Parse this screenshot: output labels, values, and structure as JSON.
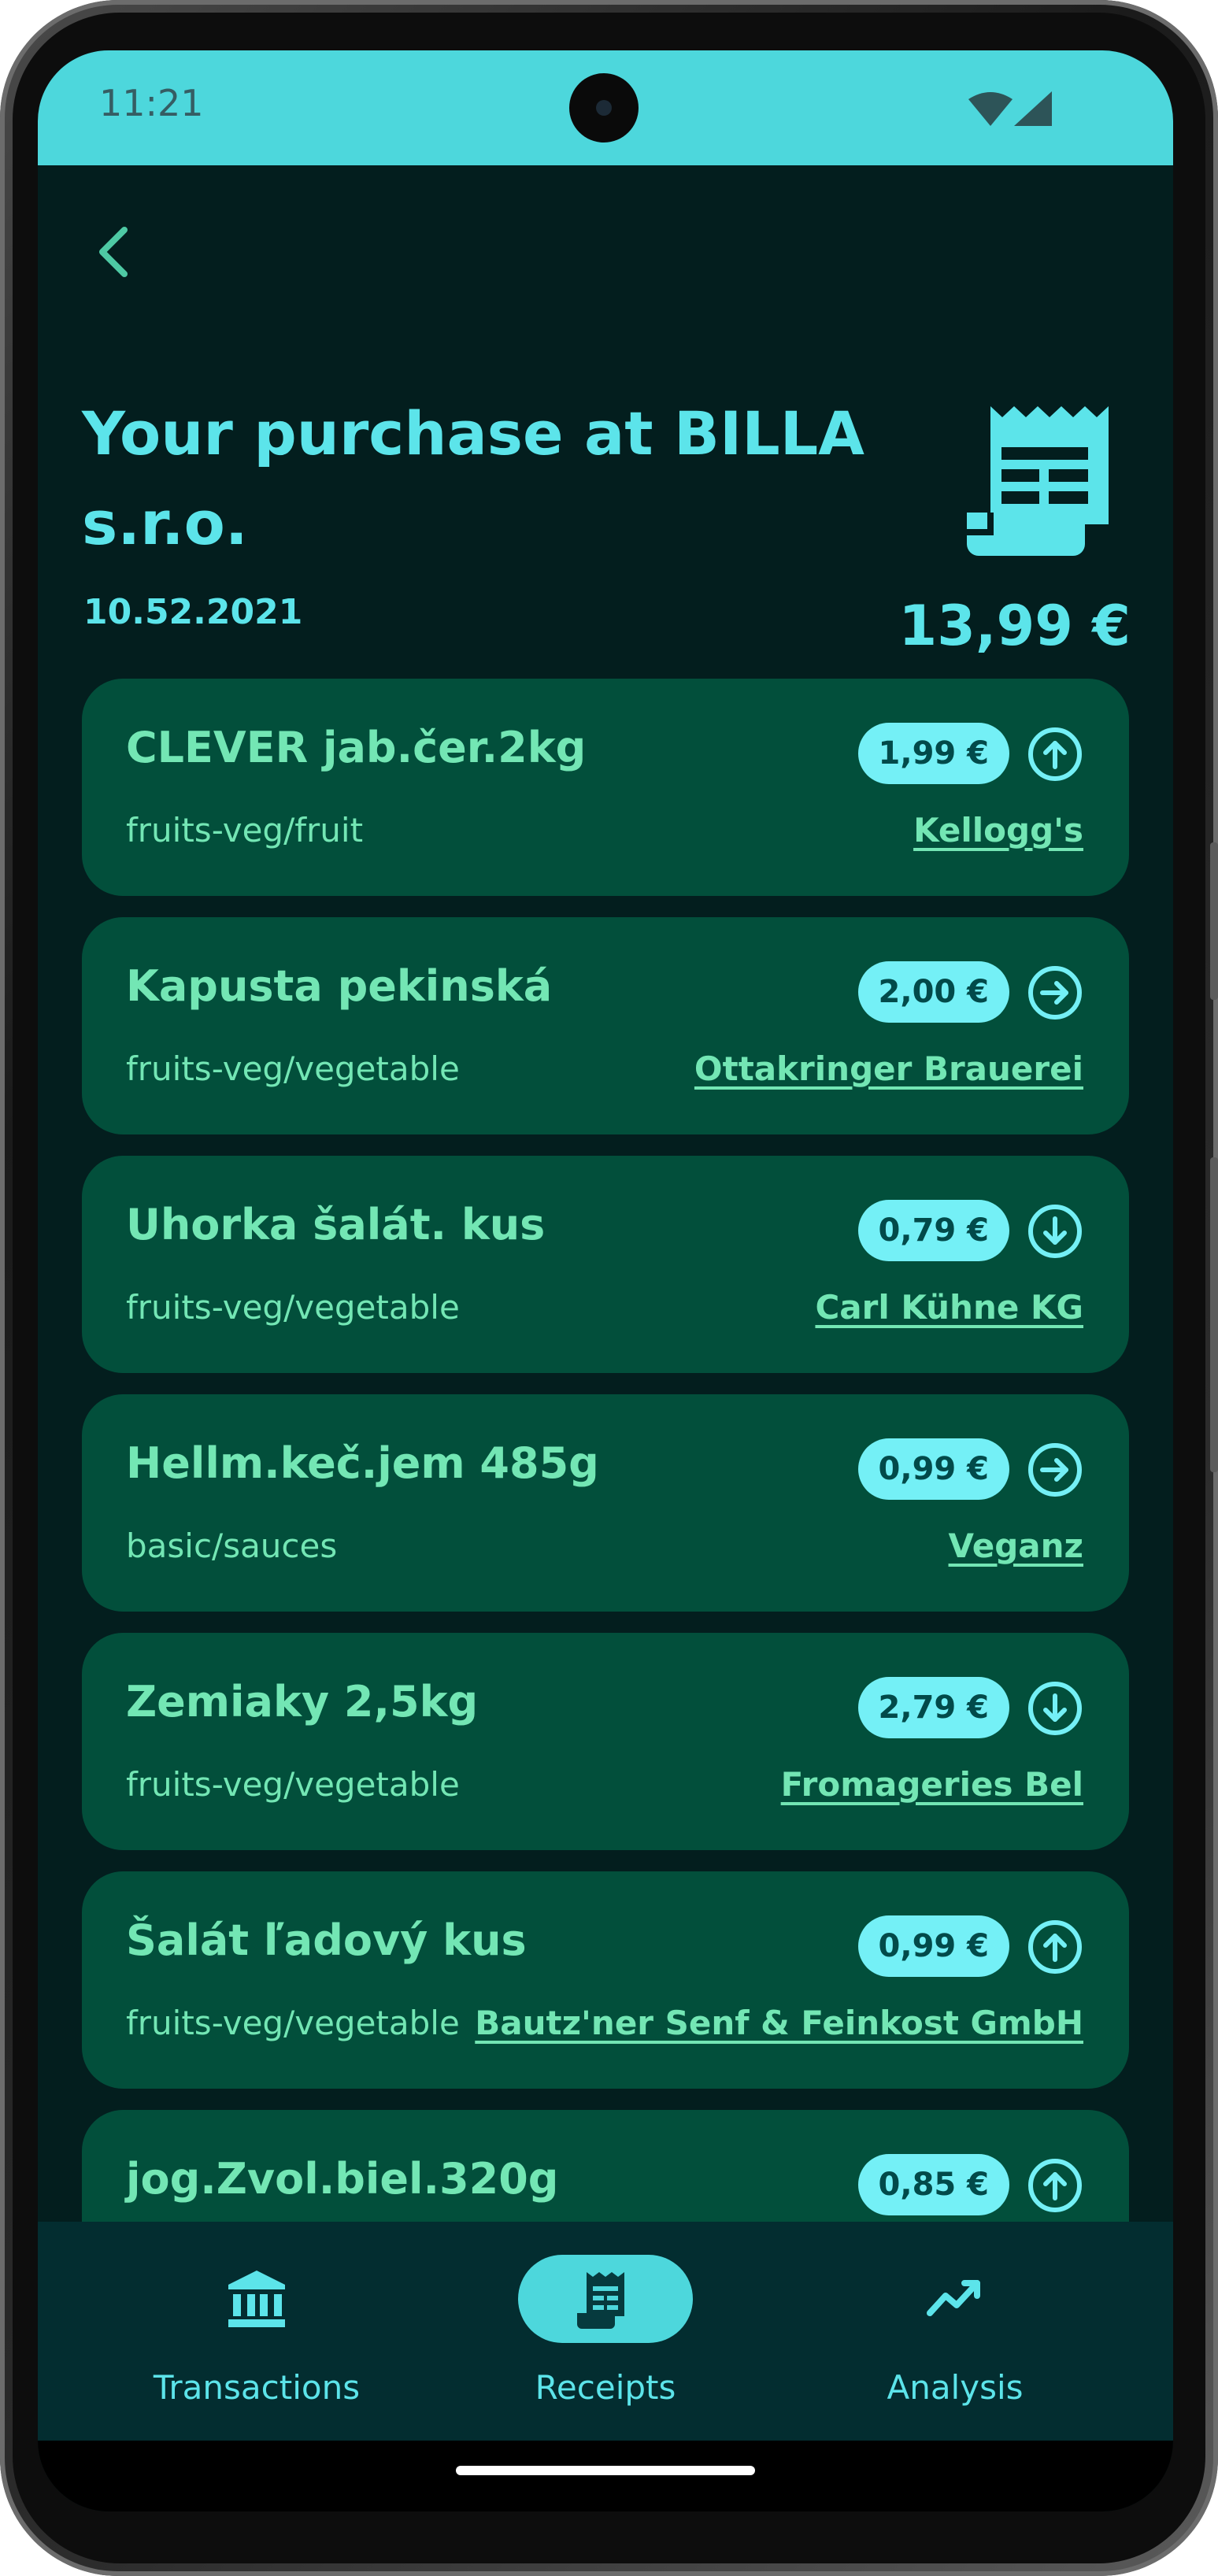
{
  "status_bar": {
    "time": "11:21"
  },
  "header": {
    "back_icon": "chevron-left-icon",
    "title": "Your purchase at BILLA s.r.o.",
    "date": "10.52.2021",
    "total": "13,99 €",
    "receipt_icon": "receipt-icon"
  },
  "items": [
    {
      "name": "CLEVER jab.čer.2kg",
      "category": "fruits-veg/fruit",
      "price": "1,99 €",
      "brand": "Kellogg's",
      "trend": "up"
    },
    {
      "name": "Kapusta pekinská",
      "category": "fruits-veg/vegetable",
      "price": "2,00 €",
      "brand": "Ottakringer Brauerei",
      "trend": "right"
    },
    {
      "name": "Uhorka šalát. kus",
      "category": "fruits-veg/vegetable",
      "price": "0,79 €",
      "brand": "Carl Kühne KG",
      "trend": "down"
    },
    {
      "name": "Hellm.keč.jem 485g",
      "category": "basic/sauces",
      "price": "0,99 €",
      "brand": "Veganz",
      "trend": "right"
    },
    {
      "name": "Zemiaky 2,5kg",
      "category": "fruits-veg/vegetable",
      "price": "2,79 €",
      "brand": "Fromageries Bel",
      "trend": "down"
    },
    {
      "name": "Šalát ľadový kus",
      "category": "fruits-veg/vegetable",
      "price": "0,99 €",
      "brand": "Bautz'ner Senf & Feinkost GmbH",
      "trend": "up"
    },
    {
      "name": "jog.Zvol.biel.320g",
      "category": "",
      "price": "0,85 €",
      "brand": "",
      "trend": "up"
    }
  ],
  "bottom_nav": {
    "items": [
      {
        "label": "Transactions",
        "icon": "bank-icon",
        "active": false
      },
      {
        "label": "Receipts",
        "icon": "receipt-icon",
        "active": true
      },
      {
        "label": "Analysis",
        "icon": "trending-up-icon",
        "active": false
      }
    ]
  },
  "colors": {
    "background": "#031e1e",
    "status_bar": "#4dd7dc",
    "accent": "#5ce4ea",
    "card": "#024f3b",
    "card_text": "#73e6b4",
    "price_pill": "#74f0f6",
    "bottom_nav": "#032d30"
  }
}
